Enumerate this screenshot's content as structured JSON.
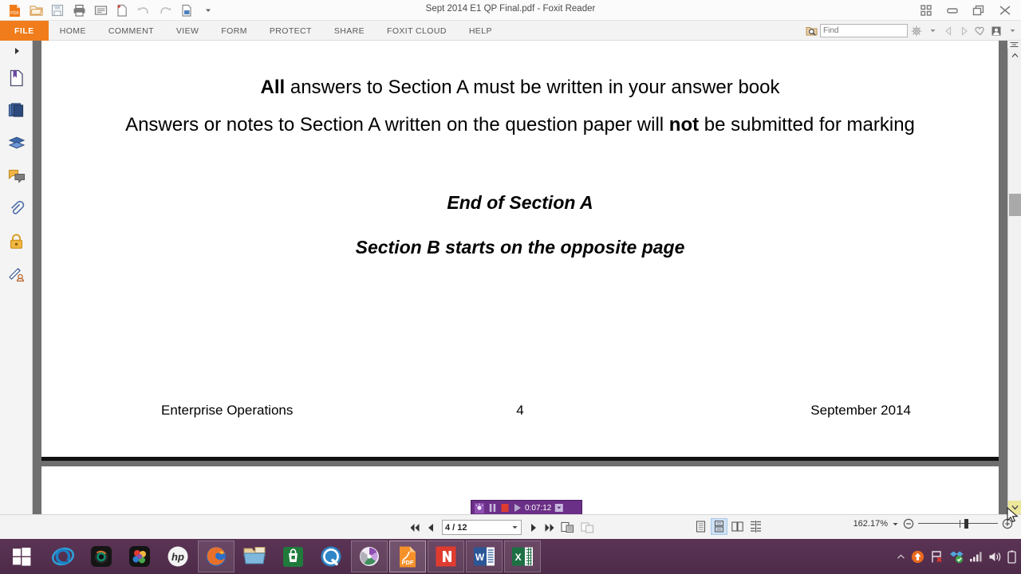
{
  "window": {
    "title": "Sept 2014 E1 QP Final.pdf - Foxit Reader",
    "controls": [
      {
        "name": "ribbon-options-icon",
        "label": "▣"
      },
      {
        "name": "minimize-button",
        "label": "–"
      },
      {
        "name": "restore-button",
        "label": "❐"
      },
      {
        "name": "close-button",
        "label": "✕"
      }
    ]
  },
  "quick_access": [
    {
      "name": "pdf-logo-icon",
      "label": "PDF"
    },
    {
      "name": "open-file-icon",
      "label": "Open"
    },
    {
      "name": "save-icon",
      "label": "Save"
    },
    {
      "name": "print-icon",
      "label": "Print"
    },
    {
      "name": "email-icon",
      "label": "Email"
    },
    {
      "name": "create-pdf-icon",
      "label": "Create PDF"
    },
    {
      "name": "undo-icon",
      "label": "Undo"
    },
    {
      "name": "redo-icon",
      "label": "Redo"
    },
    {
      "name": "export-icon",
      "label": "Export"
    },
    {
      "name": "customize-toolbar-icon",
      "label": "▾"
    }
  ],
  "menu": {
    "tabs": [
      {
        "name": "tab-file",
        "label": "FILE"
      },
      {
        "name": "tab-home",
        "label": "HOME"
      },
      {
        "name": "tab-comment",
        "label": "COMMENT"
      },
      {
        "name": "tab-view",
        "label": "VIEW"
      },
      {
        "name": "tab-form",
        "label": "FORM"
      },
      {
        "name": "tab-protect",
        "label": "PROTECT"
      },
      {
        "name": "tab-share",
        "label": "SHARE"
      },
      {
        "name": "tab-foxit-cloud",
        "label": "FOXIT CLOUD"
      },
      {
        "name": "tab-help",
        "label": "HELP"
      }
    ],
    "active_tab": "FILE",
    "accent_color": "#f07c1b"
  },
  "search": {
    "placeholder": "Find",
    "value": ""
  },
  "menu_right_icons": [
    {
      "name": "advanced-search-icon",
      "label": "Search"
    },
    {
      "name": "settings-gear-icon",
      "label": "Settings"
    },
    {
      "name": "settings-dropdown-icon",
      "label": "▾"
    },
    {
      "name": "previous-view-icon",
      "label": "◁"
    },
    {
      "name": "next-view-icon",
      "label": "▷"
    },
    {
      "name": "favorites-heart-icon",
      "label": "♡"
    },
    {
      "name": "account-icon",
      "label": "Account"
    },
    {
      "name": "account-dropdown-icon",
      "label": "▾"
    }
  ],
  "left_nav": [
    {
      "name": "expand-panel-icon",
      "label": "▸"
    },
    {
      "name": "bookmarks-icon",
      "label": "Bookmarks"
    },
    {
      "name": "page-thumbnails-icon",
      "label": "Page Thumbnails"
    },
    {
      "name": "layers-icon",
      "label": "Layers"
    },
    {
      "name": "comments-icon",
      "label": "Comments"
    },
    {
      "name": "attachments-icon",
      "label": "Attachments"
    },
    {
      "name": "security-lock-icon",
      "label": "Security"
    },
    {
      "name": "digital-signature-icon",
      "label": "Digital Signatures"
    }
  ],
  "document": {
    "line_1_bold": "All",
    "line_1_rest": " answers to Section A must be written in your answer book",
    "line_2_a": "Answers or notes to Section A written on the question paper will ",
    "line_2_bold": "not",
    "line_2_b": " be submitted for marking",
    "line_3": "End of Section A",
    "line_4": "Section B starts on the opposite page",
    "footer_left": "Enterprise Operations",
    "footer_center": "4",
    "footer_right": "September 2014"
  },
  "recorder": {
    "pause_label": "‖",
    "stop_label": "■",
    "play_label": "▶",
    "time": "0:07:12",
    "menu_label": "▣"
  },
  "status": {
    "first_page_label": "◀◀",
    "prev_page_label": "◀",
    "page_value": "4 / 12",
    "page_dropdown_label": "▾",
    "next_page_label": "▶",
    "last_page_label": "▶▶",
    "view_tools": [
      {
        "name": "single-page-view-button",
        "label": "Single Page"
      },
      {
        "name": "continuous-scroll-view-button",
        "label": "Continuous"
      },
      {
        "name": "facing-view-button",
        "label": "Facing"
      },
      {
        "name": "continuous-facing-view-button",
        "label": "Continuous Facing"
      }
    ],
    "active_view_index": 1,
    "extra_tools": [
      {
        "name": "fit-page-button",
        "label": "Fit Page"
      },
      {
        "name": "split-view-button",
        "label": "Split View"
      }
    ],
    "zoom_value": "162.17%",
    "zoom_dropdown_label": "▾",
    "zoom_out_label": "−",
    "zoom_in_label": "+"
  },
  "scrollbar": {
    "up_label": "∧",
    "down_label": "∨",
    "split_label": "⬍"
  },
  "taskbar": {
    "start_label": "Start",
    "items": [
      {
        "name": "taskbar-internet-explorer",
        "label": "Internet Explorer",
        "state": "normal"
      },
      {
        "name": "taskbar-camera-app",
        "label": "Camera",
        "state": "normal"
      },
      {
        "name": "taskbar-photos-app",
        "label": "Photos",
        "state": "normal"
      },
      {
        "name": "taskbar-hp-app",
        "label": "HP",
        "state": "normal"
      },
      {
        "name": "taskbar-firefox",
        "label": "Mozilla Firefox",
        "state": "grouped"
      },
      {
        "name": "taskbar-file-explorer",
        "label": "File Explorer",
        "state": "normal"
      },
      {
        "name": "taskbar-store",
        "label": "Store",
        "state": "normal"
      },
      {
        "name": "taskbar-quicktime",
        "label": "QuickTime",
        "state": "normal"
      },
      {
        "name": "taskbar-screen-recorder",
        "label": "Screen Recorder",
        "state": "grouped"
      },
      {
        "name": "taskbar-foxit-reader",
        "label": "Foxit Reader",
        "state": "active"
      },
      {
        "name": "taskbar-nitro-pdf",
        "label": "Nitro PDF",
        "state": "grouped"
      },
      {
        "name": "taskbar-word",
        "label": "Microsoft Word",
        "state": "grouped"
      },
      {
        "name": "taskbar-excel",
        "label": "Microsoft Excel",
        "state": "grouped"
      }
    ],
    "tray": [
      {
        "name": "show-hidden-icons-icon",
        "label": "▲"
      },
      {
        "name": "updates-icon",
        "label": "Update"
      },
      {
        "name": "network-flag-icon",
        "label": "Action Center"
      },
      {
        "name": "dropbox-icon",
        "label": "Dropbox"
      },
      {
        "name": "signal-strength-icon",
        "label": "Network"
      },
      {
        "name": "volume-icon",
        "label": "Volume"
      },
      {
        "name": "battery-icon",
        "label": "Battery"
      }
    ]
  }
}
